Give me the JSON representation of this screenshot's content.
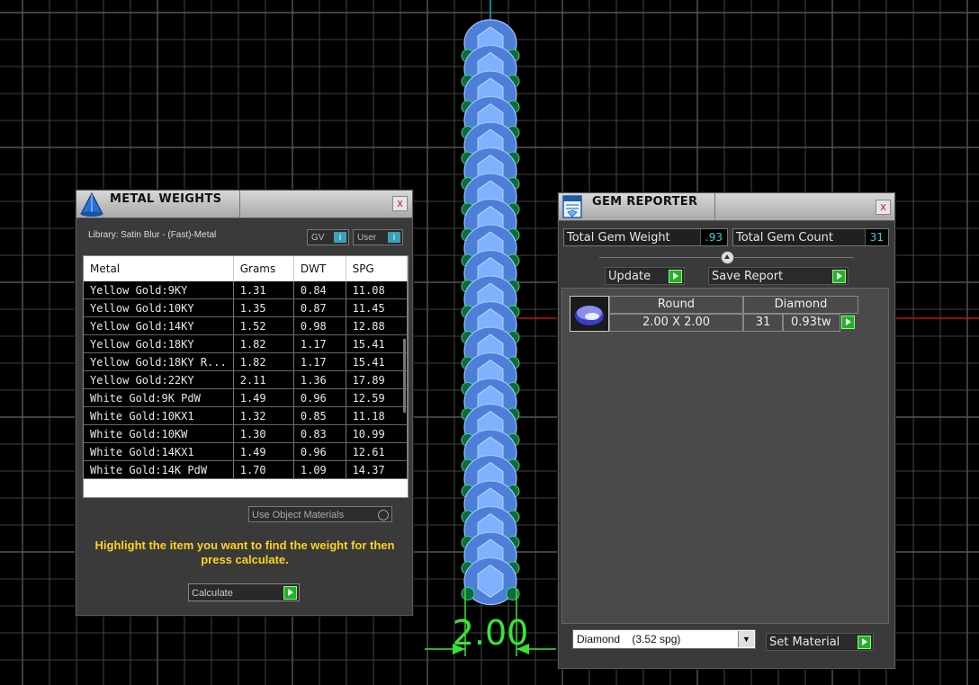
{
  "dimension": {
    "value": "2.00"
  },
  "metal_weights": {
    "title": "METAL WEIGHTS",
    "close": "x",
    "library": "Library: Satin Blur - (Fast)-Metal",
    "gv_label": "GV",
    "user_label": "User",
    "toggle_mark": "I",
    "columns": [
      "Metal",
      "Grams",
      "DWT",
      "SPG"
    ],
    "rows": [
      [
        "Yellow Gold:9KY",
        "1.31",
        "0.84",
        "11.08"
      ],
      [
        "Yellow Gold:10KY",
        "1.35",
        "0.87",
        "11.45"
      ],
      [
        "Yellow Gold:14KY",
        "1.52",
        "0.98",
        "12.88"
      ],
      [
        "Yellow Gold:18KY",
        "1.82",
        "1.17",
        "15.41"
      ],
      [
        "Yellow Gold:18KY R...",
        "1.82",
        "1.17",
        "15.41"
      ],
      [
        "Yellow Gold:22KY",
        "2.11",
        "1.36",
        "17.89"
      ],
      [
        "White Gold:9K PdW",
        "1.49",
        "0.96",
        "12.59"
      ],
      [
        "White Gold:10KX1",
        "1.32",
        "0.85",
        "11.18"
      ],
      [
        "White Gold:10KW",
        "1.30",
        "0.83",
        "10.99"
      ],
      [
        "White Gold:14KX1",
        "1.49",
        "0.96",
        "12.61"
      ],
      [
        "White Gold:14K PdW",
        "1.70",
        "1.09",
        "14.37"
      ]
    ],
    "use_object_materials": "Use Object Materials",
    "hint": "Highlight the item you want to find the weight for then press calculate.",
    "calculate": "Calculate"
  },
  "gem_reporter": {
    "title": "GEM REPORTER",
    "close": "x",
    "total_weight_label": "Total Gem Weight",
    "total_weight_value": ".93",
    "total_count_label": "Total Gem Count",
    "total_count_value": "31",
    "update_label": "Update",
    "save_report_label": "Save Report",
    "gem": {
      "shape": "Round",
      "material": "Diamond",
      "size": "2.00 X 2.00",
      "count": "31",
      "weight": "0.93tw"
    },
    "material_select": "Diamond    (3.52 spg)",
    "set_material_label": "Set Material"
  },
  "colors": {
    "grid": "#555555",
    "accent_green": "#1fb51f",
    "value_cyan": "#2ed4e6",
    "hint_yellow": "#ffd21f"
  }
}
